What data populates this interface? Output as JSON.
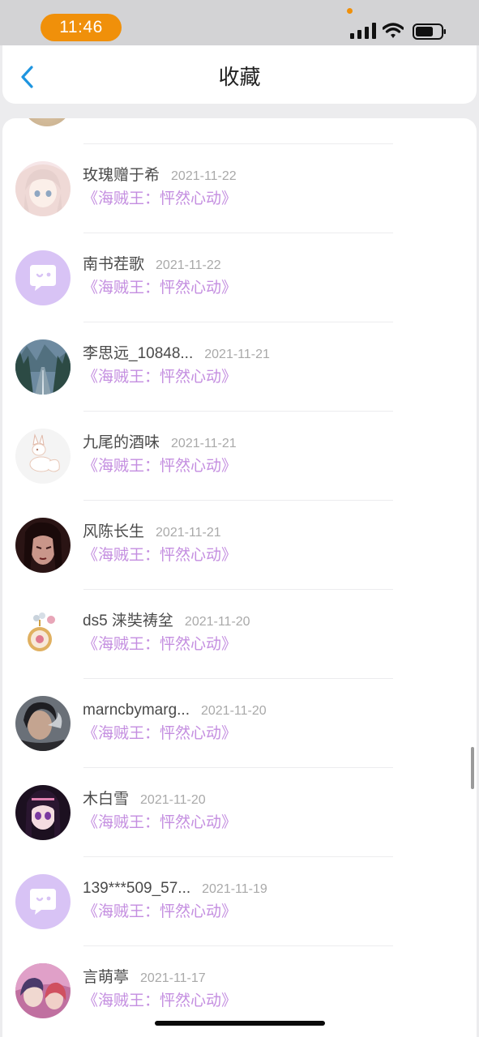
{
  "status_bar": {
    "time": "11:46"
  },
  "header": {
    "title": "收藏"
  },
  "items": [
    {
      "name": "玫瑰赠于希",
      "date": "2021-11-22",
      "work": "《海贼王：怦然心动》",
      "avatar_icon": "anime-girl-avatar"
    },
    {
      "name": "南书茬歌",
      "date": "2021-11-22",
      "work": "《海贼王：怦然心动》",
      "avatar_icon": "default-chat-avatar"
    },
    {
      "name": "李思远_10848...",
      "date": "2021-11-21",
      "work": "《海贼王：怦然心动》",
      "avatar_icon": "forest-road-avatar"
    },
    {
      "name": "九尾的酒味",
      "date": "2021-11-21",
      "work": "《海贼王：怦然心动》",
      "avatar_icon": "white-fox-avatar"
    },
    {
      "name": "风陈长生",
      "date": "2021-11-21",
      "work": "《海贼王：怦然心动》",
      "avatar_icon": "dark-portrait-avatar"
    },
    {
      "name": "ds5 涞奘祷坌",
      "date": "2021-11-20",
      "work": "《海贼王：怦然心动》",
      "avatar_icon": "pocket-watch-avatar"
    },
    {
      "name": "marncbymarg...",
      "date": "2021-11-20",
      "work": "《海贼王：怦然心动》",
      "avatar_icon": "smoke-portrait-avatar"
    },
    {
      "name": "木白雪",
      "date": "2021-11-20",
      "work": "《海贼王：怦然心动》",
      "avatar_icon": "anime-dark-hair-avatar"
    },
    {
      "name": "139***509_57...",
      "date": "2021-11-19",
      "work": "《海贼王：怦然心动》",
      "avatar_icon": "default-chat-avatar"
    },
    {
      "name": "言萌葶",
      "date": "2021-11-17",
      "work": "《海贼王：怦然心动》",
      "avatar_icon": "anime-pair-avatar"
    }
  ],
  "colors": {
    "accent_orange": "#f0900a",
    "back_blue": "#1e95e0",
    "work_purple": "#c48ee0",
    "default_avatar": "#d8c3f5"
  }
}
